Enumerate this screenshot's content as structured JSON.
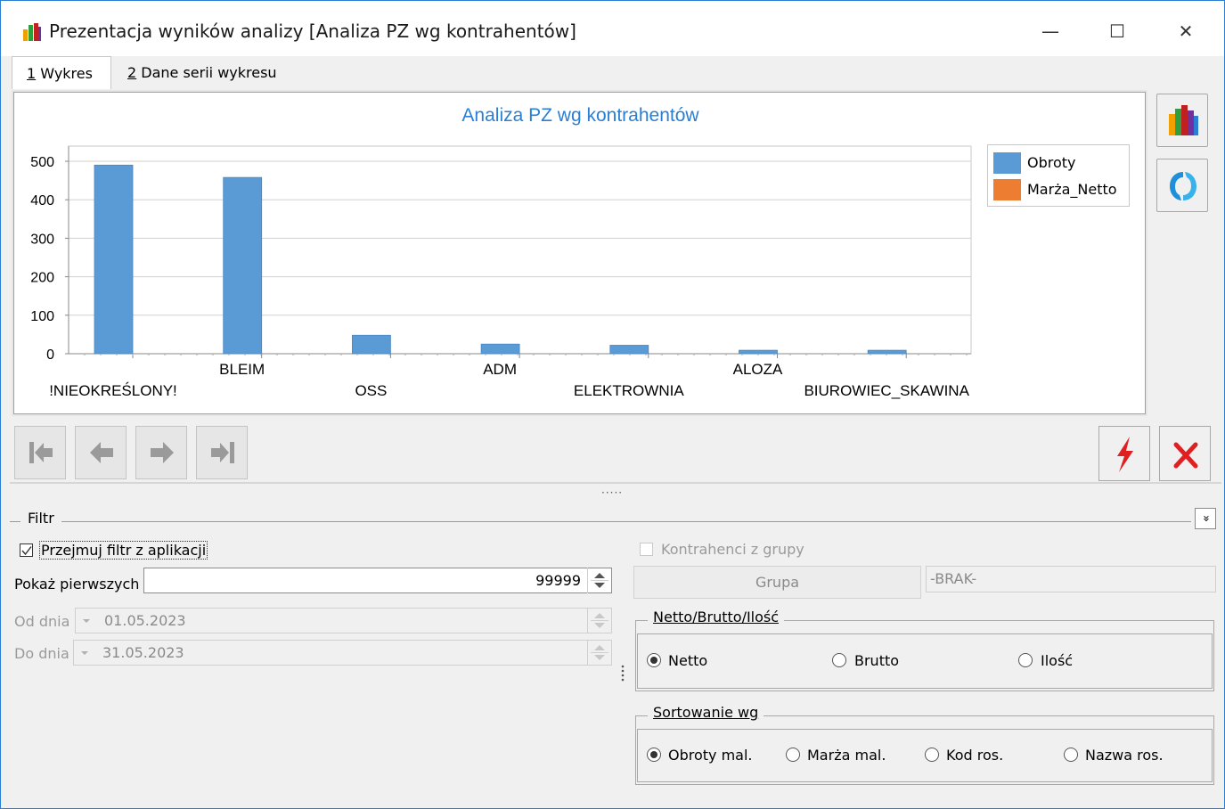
{
  "window": {
    "title": "Prezentacja wyników analizy [Analiza PZ wg kontrahentów]",
    "minimize_glyph": "—",
    "maximize_glyph": "☐",
    "close_glyph": "✕"
  },
  "tabs": [
    {
      "key": "1",
      "label": " Wykres"
    },
    {
      "key": "2",
      "label": " Dane serii wykresu"
    }
  ],
  "chart_data": {
    "type": "bar",
    "title": "Analiza PZ wg kontrahentów",
    "categories": [
      "!NIEOKREŚLONY!",
      "BLEIM",
      "OSS",
      "ADM",
      "ELEKTROWNIA",
      "ALOZA",
      "BIUROWIEC_SKAWINA"
    ],
    "series": [
      {
        "name": "Obroty",
        "color": "#5b9bd5",
        "values": [
          490,
          458,
          48,
          25,
          22,
          9,
          9
        ]
      },
      {
        "name": "Marża_Netto",
        "color": "#ed7d31",
        "values": [
          0,
          0,
          0,
          0,
          0,
          0,
          0
        ]
      }
    ],
    "yticks": [
      "0",
      "100",
      "200",
      "300",
      "400",
      "500"
    ],
    "ylim": [
      0,
      500
    ],
    "grid": true,
    "legend_position": "top-right"
  },
  "icons": {
    "side_chart": "bar-chart-icon",
    "side_refresh": "refresh-icon",
    "nav_first": "first-record-icon",
    "nav_prev": "previous-record-icon",
    "nav_next": "next-record-icon",
    "nav_last": "last-record-icon",
    "run": "lightning-icon",
    "close": "close-red-icon"
  },
  "colors": {
    "accent": "#2a7fd4",
    "bar": "#5b9bd5",
    "lightning": "#e02020",
    "close": "#e02020"
  },
  "splitter_grip": "·····",
  "filter": {
    "title": "Filtr",
    "collapse_glyph": "»",
    "przejmuj_label": "Przejmuj filtr z aplikacji",
    "przejmuj_checked": true,
    "pokaz_label": "Pokaż pierwszych",
    "pokaz_value": "99999",
    "od_label": "Od dnia",
    "od_value": "01.05.2023",
    "do_label": "Do dnia",
    "do_value": "31.05.2023",
    "kontrahenci_label": "Kontrahenci z grupy",
    "grupa_button": "Grupa",
    "grupa_value": "-BRAK-",
    "netto_group_title": "Netto/Brutto/Ilość",
    "netto_options": [
      "Netto",
      "Brutto",
      "Ilość"
    ],
    "netto_selected": "Netto",
    "sort_group_title": "Sortowanie wg",
    "sort_options": [
      "Obroty mal.",
      "Marża mal.",
      "Kod ros.",
      "Nazwa ros."
    ],
    "sort_selected": "Obroty mal."
  }
}
